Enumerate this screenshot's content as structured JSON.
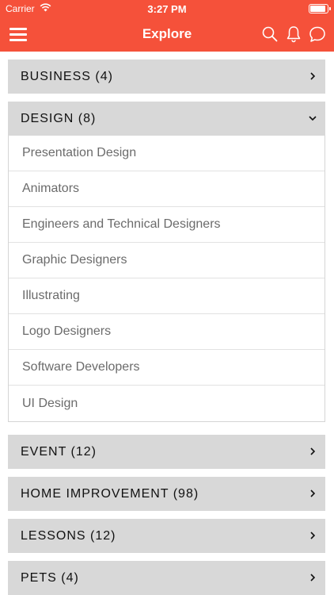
{
  "status_bar": {
    "carrier": "Carrier",
    "time": "3:27 PM"
  },
  "nav": {
    "title": "Explore",
    "icons": [
      "menu-icon",
      "search-icon",
      "bell-icon",
      "chat-icon"
    ]
  },
  "colors": {
    "header": "#f5513a",
    "category_bg": "#d8d8d8",
    "sub_text": "#6b6b6b"
  },
  "categories": [
    {
      "label": "BUSINESS (4)",
      "expanded": false
    },
    {
      "label": "DESIGN (8)",
      "expanded": true,
      "items": [
        "Presentation Design",
        "Animators",
        "Engineers and Technical Designers",
        "Graphic Designers",
        "Illustrating",
        "Logo Designers",
        "Software Developers",
        "UI Design"
      ]
    },
    {
      "label": "EVENT (12)",
      "expanded": false
    },
    {
      "label": "HOME IMPROVEMENT (98)",
      "expanded": false
    },
    {
      "label": "LESSONS (12)",
      "expanded": false
    },
    {
      "label": "PETS (4)",
      "expanded": false
    }
  ]
}
